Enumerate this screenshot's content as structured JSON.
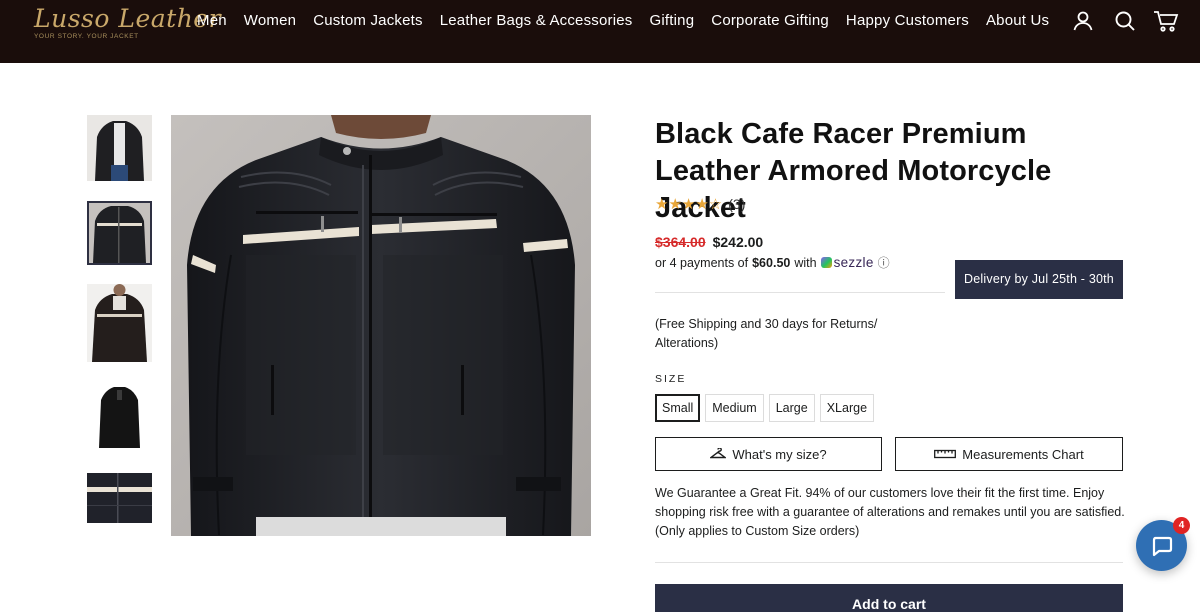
{
  "header": {
    "logo_text": "Lusso Leather",
    "logo_tagline": "YOUR STORY. YOUR JACKET",
    "nav": [
      {
        "label": "Men"
      },
      {
        "label": "Women"
      },
      {
        "label": "Custom Jackets"
      },
      {
        "label": "Leather Bags & Accessories"
      },
      {
        "label": "Gifting"
      },
      {
        "label": "Corporate Gifting"
      },
      {
        "label": "Happy Customers"
      },
      {
        "label": "About Us"
      }
    ],
    "icons": [
      "account-icon",
      "search-icon",
      "cart-icon"
    ]
  },
  "gallery": {
    "thumbnail_count": 5,
    "active_thumbnail": 2
  },
  "product": {
    "title": "Black Cafe Racer Premium Leather Armored Motorcycle Jacket",
    "rating": {
      "stars": "★★★★☆",
      "value": 4,
      "max": 5,
      "review_count": "(3)"
    },
    "price": {
      "compare_at": "$364.00",
      "sale": "$242.00"
    },
    "sezzle": {
      "prefix": "or 4 payments of",
      "amount": "$60.50",
      "suffix": "with",
      "brand": "sezzle",
      "info_icon": "ⓘ"
    },
    "delivery_badge": "Delivery by Jul 25th - 30th",
    "shipping_note": "(Free Shipping and 30 days for Returns/ Alterations)",
    "size": {
      "label": "SIZE",
      "options": [
        "Small",
        "Medium",
        "Large",
        "XLarge"
      ],
      "selected": "Small"
    },
    "fit_buttons": {
      "whats_my_size": "What's my size?",
      "measurements_chart": "Measurements Chart"
    },
    "guarantee_text": "We Guarantee a Great Fit. 94% of our customers love their fit the first time. Enjoy shopping risk free with a guarantee of alterations and remakes until you are satisfied. (Only applies to Custom Size orders)",
    "add_to_cart": "Add to cart"
  },
  "chat": {
    "badge_count": "4"
  },
  "colors": {
    "header_bg": "#1a0d0b",
    "accent_dark": "#2a2f45",
    "sale_red": "#d62a2a",
    "star": "#e9a73a",
    "chat_blue": "#2f6fb4"
  }
}
